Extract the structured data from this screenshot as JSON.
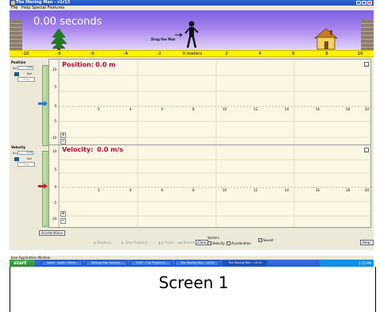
{
  "window": {
    "title": "The Moving Man - v1r13",
    "buttons": {
      "minimize": "_",
      "maximize": "□",
      "close": "✕"
    }
  },
  "menu": [
    "File",
    "Help",
    "Special Features"
  ],
  "scene": {
    "time": "0.00 seconds",
    "drag_label": "Drag the Man"
  },
  "ruler": {
    "ticks": [
      "-10",
      "-8",
      "-6",
      "-4",
      "-2",
      "0 meters",
      "2",
      "4",
      "6",
      "8",
      "10"
    ]
  },
  "position_panel": {
    "side_label": "Position",
    "value_label": "x=",
    "value": "0.0",
    "go_label": "Go!",
    "stop_label": "Stop",
    "graph_title": "Position:",
    "graph_value": "0.0 m",
    "y_ticks": [
      "10",
      "5",
      "0",
      "-5",
      "-10"
    ],
    "x_ticks": [
      "2",
      "4",
      "6",
      "8",
      "10",
      "12",
      "14",
      "16",
      "18",
      "20"
    ]
  },
  "velocity_panel": {
    "side_label": "Velocity",
    "value_label": "v=",
    "value": "0.0",
    "go_label": "Go!",
    "stop_label": "Stop",
    "graph_title": "Velocity:",
    "graph_value": "0.0 m/s",
    "y_ticks": [
      "10",
      "5",
      "0",
      "-5",
      "-10"
    ],
    "x_ticks": [
      "2",
      "4",
      "6",
      "8",
      "10",
      "12",
      "14",
      "16",
      "18",
      "20"
    ]
  },
  "controls": {
    "accelerations": "Accelerations",
    "playback": "Playback",
    "slow_playback": "Slow Playback",
    "pause": "Pause",
    "rewind": "Rewind",
    "clear": "Clear",
    "vectors_label": "Vectors",
    "velocity": "Velocity",
    "acceleration": "Acceleration",
    "sound": "Sound",
    "help": "Help!"
  },
  "status_text": "Java Application Window",
  "taskbar": {
    "start": "start",
    "items": [
      "Inbox - vip60 - Micro...",
      "Moving Man Velocity ...",
      "PHET - The Physics E...",
      "The Moving Man - v1r13",
      "The Moving Man - v1r13"
    ],
    "clock": "1:15 PM"
  },
  "caption": "Screen 1",
  "colors": {
    "accent_red": "#b8003c",
    "ruler_yellow": "#fff200",
    "sky_purple": "#7b5fe0"
  }
}
